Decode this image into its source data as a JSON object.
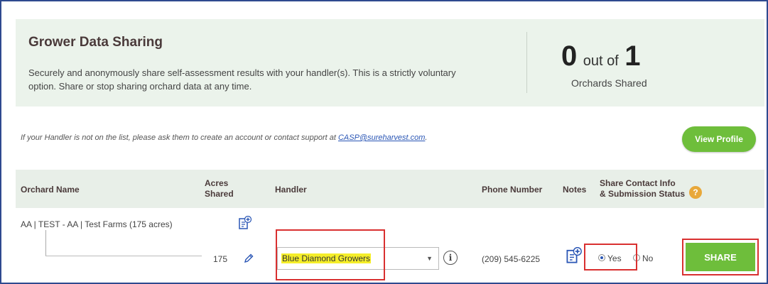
{
  "header": {
    "title": "Grower Data Sharing",
    "description": "Securely and anonymously share self-assessment results with your handler(s). This is a strictly voluntary option. Share or stop sharing orchard data at any time.",
    "shared_count": "0",
    "count_separator": "out of",
    "total_count": "1",
    "count_label": "Orchards Shared"
  },
  "notice": {
    "text": "If your Handler is not on the list, please ask them to create an account or contact support at",
    "email": "CASP@sureharvest.com",
    "end": "."
  },
  "view_profile_label": "View Profile",
  "table": {
    "columns": {
      "orchard_name": "Orchard Name",
      "acres_line1": "Acres",
      "acres_line2": "Shared",
      "handler": "Handler",
      "phone": "Phone Number",
      "notes": "Notes",
      "share_line1": "Share Contact Info",
      "share_line2": "& Submission Status"
    },
    "help_icon_glyph": "?",
    "orchard": {
      "name": "AA | TEST - AA | Test Farms (175 acres)",
      "acres": "175",
      "handler": "Blue Diamond Growers",
      "phone": "(209) 545-6225",
      "share_yes": "Yes",
      "share_no": "No",
      "share_selected": "Yes"
    },
    "info_icon_glyph": "i",
    "share_button_label": "SHARE"
  },
  "colors": {
    "accent_green": "#6ebe3b",
    "highlight_red": "#d93030",
    "panel_bg": "#ebf3eb",
    "handler_highlight": "#f5ee2a"
  },
  "icons": [
    "add-notes-icon",
    "edit-pencil-icon",
    "info-icon",
    "help-icon",
    "dropdown-arrow-icon"
  ]
}
